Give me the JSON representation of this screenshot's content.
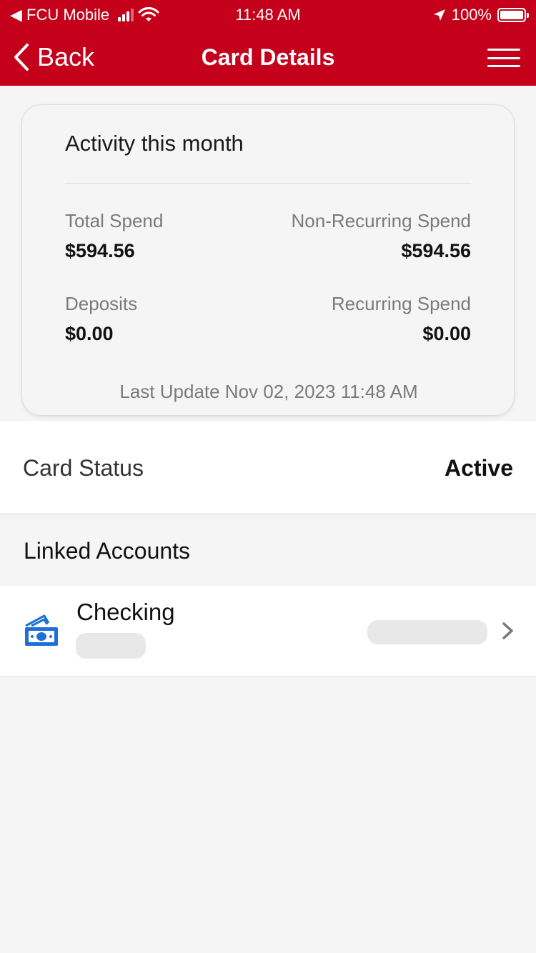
{
  "status_bar": {
    "carrier": "◀ FCU Mobile",
    "time": "11:48 AM",
    "battery": "100%"
  },
  "nav": {
    "back_label": "Back",
    "title": "Card Details"
  },
  "activity": {
    "title": "Activity this month",
    "total_spend_label": "Total Spend",
    "total_spend_value": "$594.56",
    "non_recurring_label": "Non-Recurring Spend",
    "non_recurring_value": "$594.56",
    "deposits_label": "Deposits",
    "deposits_value": "$0.00",
    "recurring_label": "Recurring Spend",
    "recurring_value": "$0.00",
    "last_update": "Last Update Nov 02, 2023 11:48 AM"
  },
  "card_status": {
    "label": "Card Status",
    "value": "Active"
  },
  "linked_accounts": {
    "header": "Linked Accounts",
    "items": [
      {
        "name": "Checking",
        "icon": "money-icon"
      }
    ]
  },
  "colors": {
    "brand_red": "#c5001a",
    "icon_blue": "#1f6fd6"
  }
}
